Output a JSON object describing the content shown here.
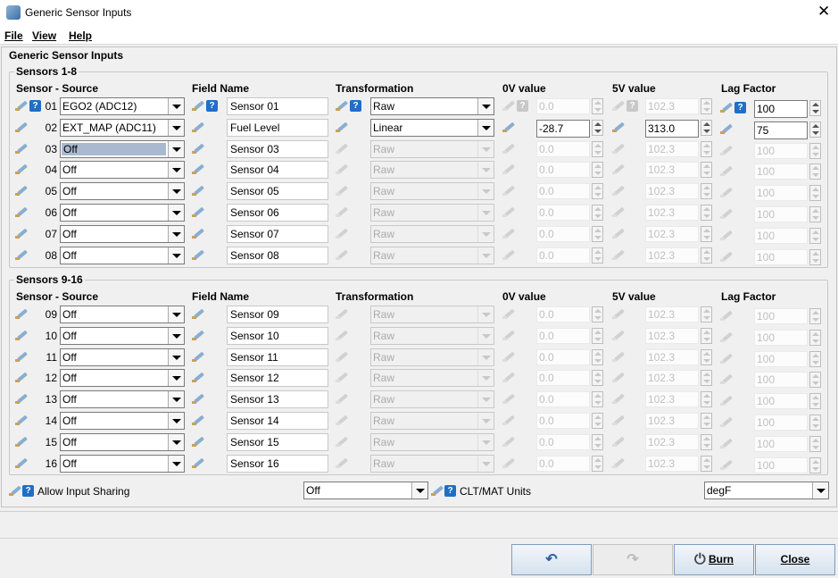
{
  "window": {
    "title": "Generic Sensor Inputs",
    "close_glyph": "✕"
  },
  "menu": [
    {
      "label": "File"
    },
    {
      "label": "View"
    },
    {
      "label": "Help"
    }
  ],
  "panel": {
    "title": "Generic Sensor Inputs"
  },
  "headers": {
    "sensor_source": "Sensor - Source",
    "field_name": "Field Name",
    "transformation": "Transformation",
    "v0": "0V value",
    "v5": "5V value",
    "lag": "Lag Factor"
  },
  "group1": {
    "title": "Sensors 1-8",
    "rows": [
      {
        "num": "01",
        "source": "EGO2 (ADC12)",
        "name": "Sensor 01",
        "transform": "Raw",
        "v0": "0.0",
        "v5": "102.3",
        "lag": "100",
        "enabled": true,
        "lag_enabled": true
      },
      {
        "num": "02",
        "source": "EXT_MAP (ADC11)",
        "name": "Fuel Level",
        "transform": "Linear",
        "v0": "-28.7",
        "v5": "313.0",
        "lag": "75",
        "enabled": true,
        "lag_enabled": true,
        "values_enabled": true
      },
      {
        "num": "03",
        "source": "Off",
        "name": "Sensor 03",
        "transform": "Raw",
        "v0": "0.0",
        "v5": "102.3",
        "lag": "100",
        "selected": true
      },
      {
        "num": "04",
        "source": "Off",
        "name": "Sensor 04",
        "transform": "Raw",
        "v0": "0.0",
        "v5": "102.3",
        "lag": "100"
      },
      {
        "num": "05",
        "source": "Off",
        "name": "Sensor 05",
        "transform": "Raw",
        "v0": "0.0",
        "v5": "102.3",
        "lag": "100"
      },
      {
        "num": "06",
        "source": "Off",
        "name": "Sensor 06",
        "transform": "Raw",
        "v0": "0.0",
        "v5": "102.3",
        "lag": "100"
      },
      {
        "num": "07",
        "source": "Off",
        "name": "Sensor 07",
        "transform": "Raw",
        "v0": "0.0",
        "v5": "102.3",
        "lag": "100"
      },
      {
        "num": "08",
        "source": "Off",
        "name": "Sensor 08",
        "transform": "Raw",
        "v0": "0.0",
        "v5": "102.3",
        "lag": "100"
      }
    ]
  },
  "group2": {
    "title": "Sensors 9-16",
    "rows": [
      {
        "num": "09",
        "source": "Off",
        "name": "Sensor 09",
        "transform": "Raw",
        "v0": "0.0",
        "v5": "102.3",
        "lag": "100"
      },
      {
        "num": "10",
        "source": "Off",
        "name": "Sensor 10",
        "transform": "Raw",
        "v0": "0.0",
        "v5": "102.3",
        "lag": "100"
      },
      {
        "num": "11",
        "source": "Off",
        "name": "Sensor 11",
        "transform": "Raw",
        "v0": "0.0",
        "v5": "102.3",
        "lag": "100"
      },
      {
        "num": "12",
        "source": "Off",
        "name": "Sensor 12",
        "transform": "Raw",
        "v0": "0.0",
        "v5": "102.3",
        "lag": "100"
      },
      {
        "num": "13",
        "source": "Off",
        "name": "Sensor 13",
        "transform": "Raw",
        "v0": "0.0",
        "v5": "102.3",
        "lag": "100"
      },
      {
        "num": "14",
        "source": "Off",
        "name": "Sensor 14",
        "transform": "Raw",
        "v0": "0.0",
        "v5": "102.3",
        "lag": "100"
      },
      {
        "num": "15",
        "source": "Off",
        "name": "Sensor 15",
        "transform": "Raw",
        "v0": "0.0",
        "v5": "102.3",
        "lag": "100"
      },
      {
        "num": "16",
        "source": "Off",
        "name": "Sensor 16",
        "transform": "Raw",
        "v0": "0.0",
        "v5": "102.3",
        "lag": "100"
      }
    ]
  },
  "footer": {
    "allow_sharing_label": "Allow Input Sharing",
    "allow_sharing_value": "Off",
    "clt_label": "CLT/MAT Units",
    "clt_value": "degF"
  },
  "buttons": {
    "undo": "",
    "redo": "",
    "burn": "Burn",
    "close": "Close"
  },
  "icons": {
    "help": "?",
    "undo": "↶",
    "redo": "↷",
    "burn": "⏻"
  }
}
